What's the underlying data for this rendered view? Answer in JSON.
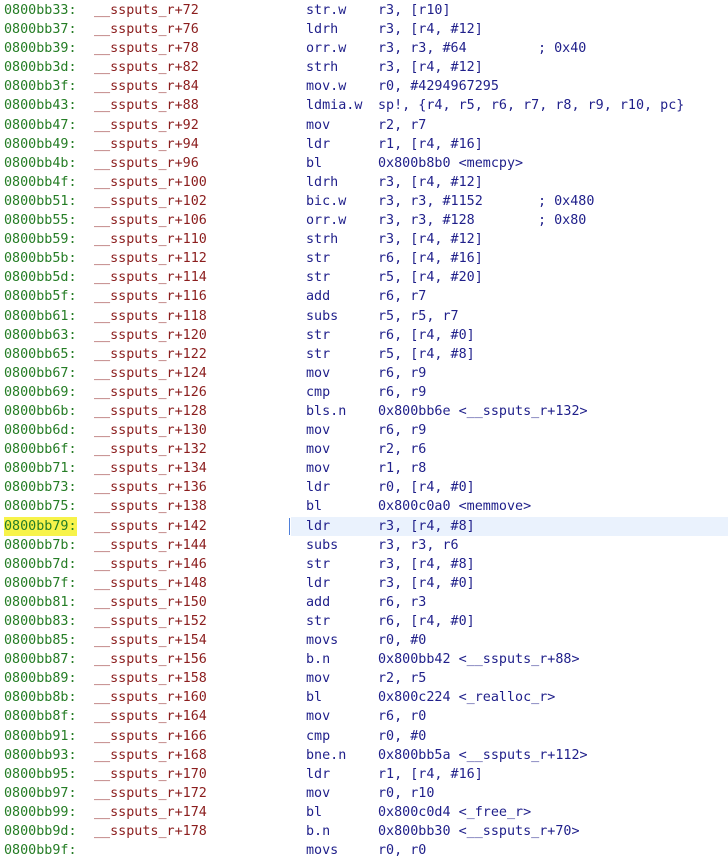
{
  "current_row": 27,
  "rows": [
    {
      "addr": "0800bb33:",
      "sym": "__ssputs_r+72",
      "mn": "str.w",
      "ops": "r3, [r10]",
      "cmt": ""
    },
    {
      "addr": "0800bb37:",
      "sym": "__ssputs_r+76",
      "mn": "ldrh",
      "ops": "r3, [r4, #12]",
      "cmt": ""
    },
    {
      "addr": "0800bb39:",
      "sym": "__ssputs_r+78",
      "mn": "orr.w",
      "ops": "r3, r3, #64",
      "cmt": "; 0x40"
    },
    {
      "addr": "0800bb3d:",
      "sym": "__ssputs_r+82",
      "mn": "strh",
      "ops": "r3, [r4, #12]",
      "cmt": ""
    },
    {
      "addr": "0800bb3f:",
      "sym": "__ssputs_r+84",
      "mn": "mov.w",
      "ops": "r0, #4294967295",
      "cmt": ""
    },
    {
      "addr": "0800bb43:",
      "sym": "__ssputs_r+88",
      "mn": "ldmia.w",
      "ops": "sp!, {r4, r5, r6, r7, r8, r9, r10, pc}",
      "cmt": ""
    },
    {
      "addr": "0800bb47:",
      "sym": "__ssputs_r+92",
      "mn": "mov",
      "ops": "r2, r7",
      "cmt": ""
    },
    {
      "addr": "0800bb49:",
      "sym": "__ssputs_r+94",
      "mn": "ldr",
      "ops": "r1, [r4, #16]",
      "cmt": ""
    },
    {
      "addr": "0800bb4b:",
      "sym": "__ssputs_r+96",
      "mn": "bl",
      "ops": "0x800b8b0 <memcpy>",
      "cmt": ""
    },
    {
      "addr": "0800bb4f:",
      "sym": "__ssputs_r+100",
      "mn": "ldrh",
      "ops": "r3, [r4, #12]",
      "cmt": ""
    },
    {
      "addr": "0800bb51:",
      "sym": "__ssputs_r+102",
      "mn": "bic.w",
      "ops": "r3, r3, #1152",
      "cmt": "; 0x480"
    },
    {
      "addr": "0800bb55:",
      "sym": "__ssputs_r+106",
      "mn": "orr.w",
      "ops": "r3, r3, #128",
      "cmt": "; 0x80"
    },
    {
      "addr": "0800bb59:",
      "sym": "__ssputs_r+110",
      "mn": "strh",
      "ops": "r3, [r4, #12]",
      "cmt": ""
    },
    {
      "addr": "0800bb5b:",
      "sym": "__ssputs_r+112",
      "mn": "str",
      "ops": "r6, [r4, #16]",
      "cmt": ""
    },
    {
      "addr": "0800bb5d:",
      "sym": "__ssputs_r+114",
      "mn": "str",
      "ops": "r5, [r4, #20]",
      "cmt": ""
    },
    {
      "addr": "0800bb5f:",
      "sym": "__ssputs_r+116",
      "mn": "add",
      "ops": "r6, r7",
      "cmt": ""
    },
    {
      "addr": "0800bb61:",
      "sym": "__ssputs_r+118",
      "mn": "subs",
      "ops": "r5, r5, r7",
      "cmt": ""
    },
    {
      "addr": "0800bb63:",
      "sym": "__ssputs_r+120",
      "mn": "str",
      "ops": "r6, [r4, #0]",
      "cmt": ""
    },
    {
      "addr": "0800bb65:",
      "sym": "__ssputs_r+122",
      "mn": "str",
      "ops": "r5, [r4, #8]",
      "cmt": ""
    },
    {
      "addr": "0800bb67:",
      "sym": "__ssputs_r+124",
      "mn": "mov",
      "ops": "r6, r9",
      "cmt": ""
    },
    {
      "addr": "0800bb69:",
      "sym": "__ssputs_r+126",
      "mn": "cmp",
      "ops": "r6, r9",
      "cmt": ""
    },
    {
      "addr": "0800bb6b:",
      "sym": "__ssputs_r+128",
      "mn": "bls.n",
      "ops": "0x800bb6e <__ssputs_r+132>",
      "cmt": ""
    },
    {
      "addr": "0800bb6d:",
      "sym": "__ssputs_r+130",
      "mn": "mov",
      "ops": "r6, r9",
      "cmt": ""
    },
    {
      "addr": "0800bb6f:",
      "sym": "__ssputs_r+132",
      "mn": "mov",
      "ops": "r2, r6",
      "cmt": ""
    },
    {
      "addr": "0800bb71:",
      "sym": "__ssputs_r+134",
      "mn": "mov",
      "ops": "r1, r8",
      "cmt": ""
    },
    {
      "addr": "0800bb73:",
      "sym": "__ssputs_r+136",
      "mn": "ldr",
      "ops": "r0, [r4, #0]",
      "cmt": ""
    },
    {
      "addr": "0800bb75:",
      "sym": "__ssputs_r+138",
      "mn": "bl",
      "ops": "0x800c0a0 <memmove>",
      "cmt": ""
    },
    {
      "addr": "0800bb79:",
      "sym": "__ssputs_r+142",
      "mn": "ldr",
      "ops": "r3, [r4, #8]",
      "cmt": ""
    },
    {
      "addr": "0800bb7b:",
      "sym": "__ssputs_r+144",
      "mn": "subs",
      "ops": "r3, r3, r6",
      "cmt": ""
    },
    {
      "addr": "0800bb7d:",
      "sym": "__ssputs_r+146",
      "mn": "str",
      "ops": "r3, [r4, #8]",
      "cmt": ""
    },
    {
      "addr": "0800bb7f:",
      "sym": "__ssputs_r+148",
      "mn": "ldr",
      "ops": "r3, [r4, #0]",
      "cmt": ""
    },
    {
      "addr": "0800bb81:",
      "sym": "__ssputs_r+150",
      "mn": "add",
      "ops": "r6, r3",
      "cmt": ""
    },
    {
      "addr": "0800bb83:",
      "sym": "__ssputs_r+152",
      "mn": "str",
      "ops": "r6, [r4, #0]",
      "cmt": ""
    },
    {
      "addr": "0800bb85:",
      "sym": "__ssputs_r+154",
      "mn": "movs",
      "ops": "r0, #0",
      "cmt": ""
    },
    {
      "addr": "0800bb87:",
      "sym": "__ssputs_r+156",
      "mn": "b.n",
      "ops": "0x800bb42 <__ssputs_r+88>",
      "cmt": ""
    },
    {
      "addr": "0800bb89:",
      "sym": "__ssputs_r+158",
      "mn": "mov",
      "ops": "r2, r5",
      "cmt": ""
    },
    {
      "addr": "0800bb8b:",
      "sym": "__ssputs_r+160",
      "mn": "bl",
      "ops": "0x800c224 <_realloc_r>",
      "cmt": ""
    },
    {
      "addr": "0800bb8f:",
      "sym": "__ssputs_r+164",
      "mn": "mov",
      "ops": "r6, r0",
      "cmt": ""
    },
    {
      "addr": "0800bb91:",
      "sym": "__ssputs_r+166",
      "mn": "cmp",
      "ops": "r0, #0",
      "cmt": ""
    },
    {
      "addr": "0800bb93:",
      "sym": "__ssputs_r+168",
      "mn": "bne.n",
      "ops": "0x800bb5a <__ssputs_r+112>",
      "cmt": ""
    },
    {
      "addr": "0800bb95:",
      "sym": "__ssputs_r+170",
      "mn": "ldr",
      "ops": "r1, [r4, #16]",
      "cmt": ""
    },
    {
      "addr": "0800bb97:",
      "sym": "__ssputs_r+172",
      "mn": "mov",
      "ops": "r0, r10",
      "cmt": ""
    },
    {
      "addr": "0800bb99:",
      "sym": "__ssputs_r+174",
      "mn": "bl",
      "ops": "0x800c0d4 <_free_r>",
      "cmt": ""
    },
    {
      "addr": "0800bb9d:",
      "sym": "__ssputs_r+178",
      "mn": "b.n",
      "ops": "0x800bb30 <__ssputs_r+70>",
      "cmt": ""
    },
    {
      "addr": "0800bb9f:",
      "sym": "",
      "mn": "movs",
      "ops": "r0, r0",
      "cmt": ""
    }
  ]
}
